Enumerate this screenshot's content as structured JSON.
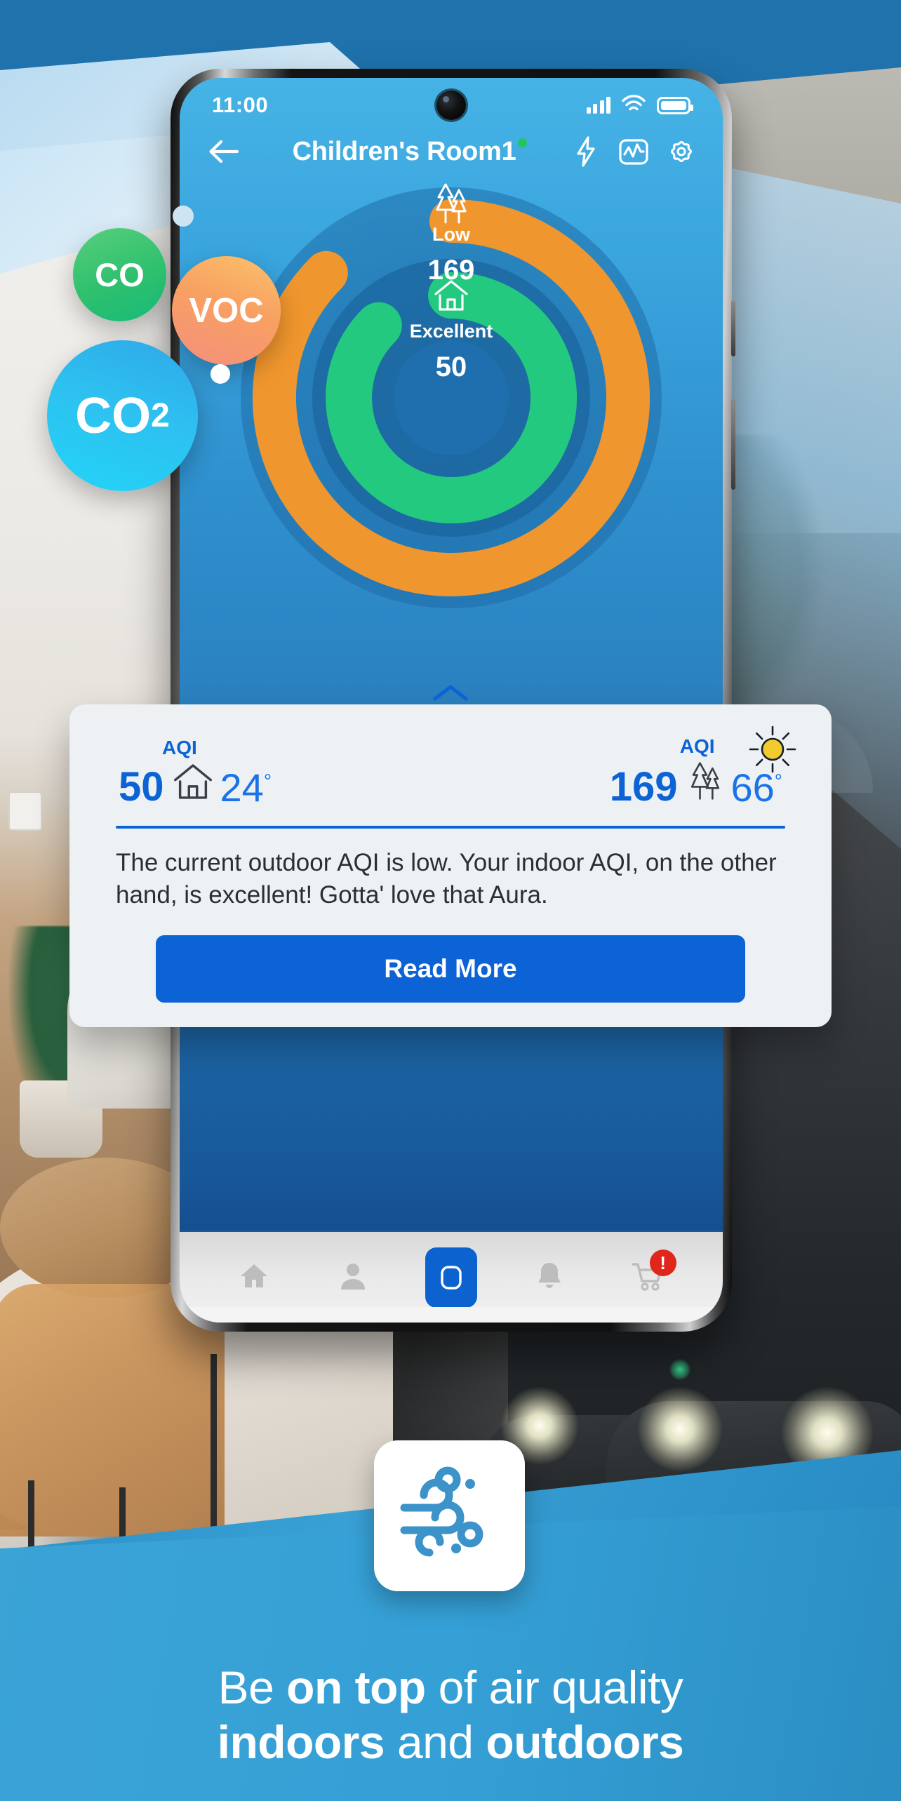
{
  "statusbar": {
    "clock": "11:00",
    "icons": [
      "signal-icon",
      "wifi-icon",
      "battery-icon"
    ]
  },
  "app_header": {
    "back_icon": "back-arrow-icon",
    "title": "Children's Room1",
    "status_dot_color": "#22c55e",
    "icons": [
      "lightning-bolt-icon",
      "chart-activity-icon",
      "gear-icon"
    ]
  },
  "gauge": {
    "outdoor": {
      "icon": "trees-icon",
      "label": "Low",
      "value": "169",
      "color": "#f0962e"
    },
    "indoor": {
      "icon": "house-icon",
      "label": "Excellent",
      "value": "50",
      "color": "#22c97e"
    }
  },
  "chart_data": {
    "type": "pie",
    "title": "Air Quality Index gauge rings",
    "series": [
      {
        "name": "Outdoor AQI",
        "label": "Low",
        "value": 169,
        "max": 500,
        "sweep_deg": 300,
        "color": "#f0962e",
        "icon": "trees-icon"
      },
      {
        "name": "Indoor AQI",
        "label": "Excellent",
        "value": 50,
        "max": 500,
        "sweep_deg": 260,
        "color": "#22c97e",
        "icon": "house-icon"
      }
    ],
    "legend": "none",
    "grid": false
  },
  "card": {
    "chevron_icon": "chevron-up-icon",
    "weather_icon": "sun-icon",
    "indoor": {
      "caption": "AQI",
      "value": "50",
      "icon": "house-icon",
      "temperature": "24",
      "degree": "°"
    },
    "outdoor": {
      "caption": "AQI",
      "value": "169",
      "icon": "trees-icon",
      "temperature": "66",
      "degree": "°"
    },
    "description": "The current outdoor AQI is low. Your indoor AQI, on the other hand, is excellent! Gotta' love that Aura.",
    "read_more_label": "Read More",
    "accent_color": "#0b63d6"
  },
  "bottom_nav": {
    "items": [
      {
        "name": "home",
        "icon": "home-icon",
        "active": false
      },
      {
        "name": "profile",
        "icon": "person-icon",
        "active": false
      },
      {
        "name": "device",
        "icon": "device-icon",
        "active": true
      },
      {
        "name": "alerts",
        "icon": "bell-icon",
        "active": false
      },
      {
        "name": "cart",
        "icon": "cart-icon",
        "active": false,
        "badge": "!"
      }
    ]
  },
  "bubbles": [
    {
      "label": "CO",
      "color": "#2fc06e"
    },
    {
      "label": "VOC",
      "color": "#f8a062"
    },
    {
      "label": "CO",
      "sub": "2",
      "color": "#22c0f0"
    }
  ],
  "logo": {
    "icon": "wind-air-icon",
    "color": "#3b93c9"
  },
  "tagline": {
    "line1_a": "Be ",
    "line1_b": "on top",
    "line1_c": " of air quality",
    "line2_a": "indoors",
    "line2_b": " and ",
    "line2_c": "outdoors"
  }
}
